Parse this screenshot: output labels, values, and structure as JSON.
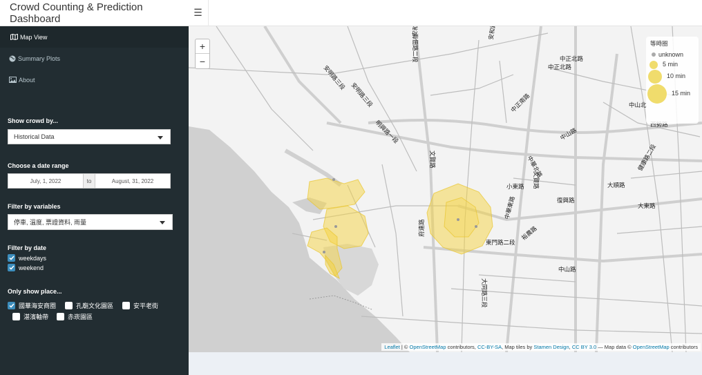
{
  "header": {
    "title": "Crowd Counting & Prediction Dashboard",
    "menu_icon": "hamburger-icon"
  },
  "sidebar": {
    "menu": [
      {
        "label": "Map View",
        "icon": "map-icon",
        "active": true
      },
      {
        "label": "Summary Plots",
        "icon": "globe-icon",
        "active": false
      },
      {
        "label": "About",
        "icon": "image-icon",
        "active": false
      }
    ],
    "crowd": {
      "label": "Show crowd by...",
      "value": "Historical Data"
    },
    "date_range": {
      "label": "Choose a date range",
      "start": "July, 1, 2022",
      "separator": "to",
      "end": "August, 31, 2022"
    },
    "variables": {
      "label": "Filter by variables",
      "value": "停車, 溫度, 票證資料, 雨量"
    },
    "filter_date": {
      "label": "Filter by date",
      "options": [
        {
          "label": "weekdays",
          "checked": true
        },
        {
          "label": "weekend",
          "checked": true
        }
      ]
    },
    "places": {
      "label": "Only show place...",
      "options": [
        {
          "label": "國華海安商圈",
          "checked": true
        },
        {
          "label": "孔廟文化園區",
          "checked": false
        },
        {
          "label": "安平老街",
          "checked": false
        },
        {
          "label": "湛濱軸帶",
          "checked": false
        },
        {
          "label": "赤崁園區",
          "checked": false
        }
      ]
    }
  },
  "map": {
    "zoom_in": "+",
    "zoom_out": "−",
    "legend": {
      "title": "等時圈",
      "items": [
        {
          "label": "unknown",
          "color": "#aaaaaa"
        },
        {
          "label": "5 min",
          "color": "#f0dc6c"
        },
        {
          "label": "10 min",
          "color": "#f0dc6c"
        },
        {
          "label": "15 min",
          "color": "#f0dc6c"
        }
      ]
    },
    "isochrone_color": "#f5d442",
    "attribution": {
      "leaflet": "Leaflet",
      "sep1": " | © ",
      "osm1": "OpenStreetMap",
      "contrib1": " contributors, ",
      "ccbysa": "CC-BY-SA",
      "maptiles": ", Map tiles by ",
      "stamen": "Stamen Design",
      "comma": ", ",
      "ccby": "CC BY 3.0",
      "mapdata": " — Map data © ",
      "osm2": "OpenStreetMap",
      "contrib2": " contributors"
    },
    "road_labels": [
      "安明路三段",
      "安明路三段",
      "海佃路二段",
      "安和路三段",
      "安和路三段",
      "中正北路",
      "中正北路",
      "中正南路",
      "明興路一段",
      "文賢路",
      "中山路",
      "中山北",
      "中華北路",
      "大順路",
      "西勢路",
      "文賢路",
      "小東路",
      "大東路",
      "中華東路",
      "東門路二段",
      "裕農路",
      "府連路",
      "中山路",
      "大同路三段",
      "健康路二段",
      "復興路"
    ]
  }
}
